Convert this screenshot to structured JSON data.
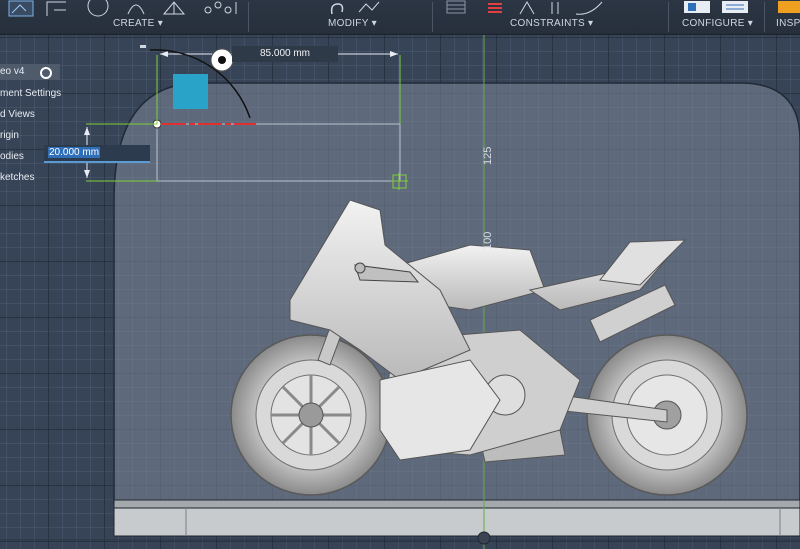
{
  "toolbar": {
    "groups": [
      {
        "label": "CREATE ▾"
      },
      {
        "label": "MODIFY ▾"
      },
      {
        "label": "CONSTRAINTS ▾"
      },
      {
        "label": "CONFIGURE ▾"
      },
      {
        "label": "INSP"
      }
    ]
  },
  "browser": {
    "items": [
      {
        "label": "eo v4"
      },
      {
        "label": "ment Settings"
      },
      {
        "label": "d Views"
      },
      {
        "label": "rigin"
      },
      {
        "label": "odies"
      },
      {
        "label": "ketches"
      }
    ]
  },
  "dimensions": {
    "width_value": "85.000 mm",
    "height_input": "20.000 mm",
    "ruler_125": "125",
    "ruler_100": "100"
  },
  "colors": {
    "toolbar_bg": "#262f3b",
    "viewport_bg": "#374457",
    "accent_blue": "#2aa3c9",
    "sketch_green": "#7fd03a",
    "sketch_red": "#e03030"
  }
}
